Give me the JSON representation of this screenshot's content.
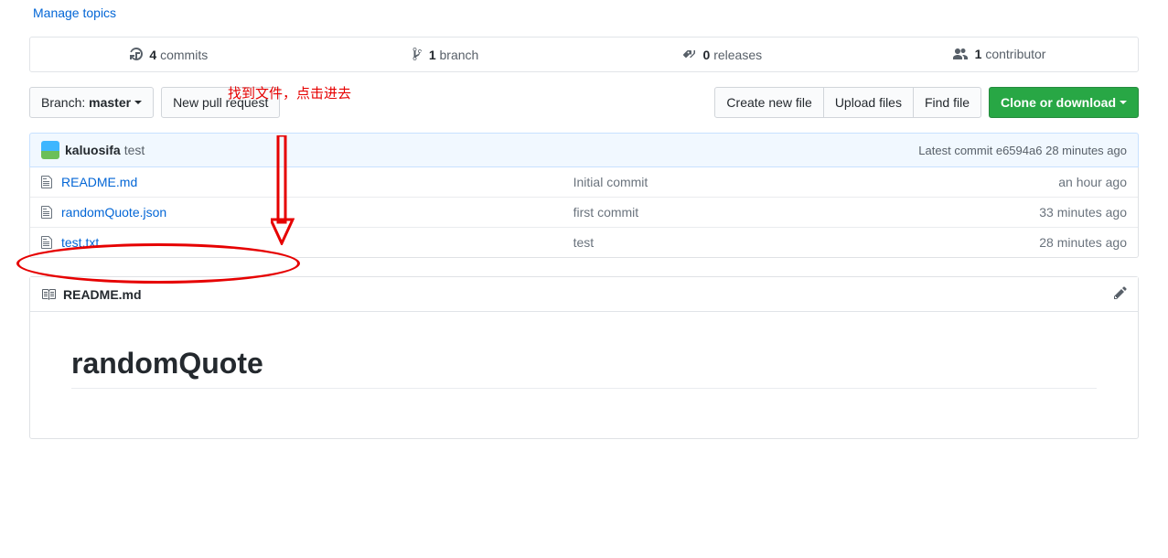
{
  "topics": {
    "manage_label": "Manage topics"
  },
  "stats": {
    "commits": {
      "count": "4",
      "label": "commits"
    },
    "branches": {
      "count": "1",
      "label": "branch"
    },
    "releases": {
      "count": "0",
      "label": "releases"
    },
    "contributors": {
      "count": "1",
      "label": "contributor"
    }
  },
  "branch_selector": {
    "prefix": "Branch:",
    "name": "master"
  },
  "buttons": {
    "new_pr": "New pull request",
    "create_file": "Create new file",
    "upload": "Upload files",
    "find_file": "Find file",
    "clone": "Clone or download"
  },
  "commit_bar": {
    "author": "kaluosifa",
    "message": "test",
    "latest_prefix": "Latest commit",
    "sha": "e6594a6",
    "time": "28 minutes ago"
  },
  "files": [
    {
      "name": "README.md",
      "message": "Initial commit",
      "time": "an hour ago"
    },
    {
      "name": "randomQuote.json",
      "message": "first commit",
      "time": "33 minutes ago"
    },
    {
      "name": "test.txt",
      "message": "test",
      "time": "28 minutes ago"
    }
  ],
  "readme": {
    "fname_label": "README.md",
    "heading": "randomQuote"
  },
  "annotations": {
    "hint": "找到文件，点击进去"
  }
}
